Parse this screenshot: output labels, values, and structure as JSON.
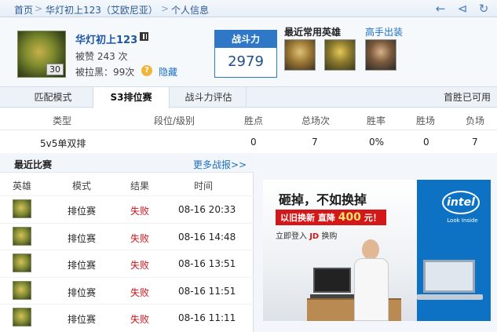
{
  "breadcrumb": {
    "home": "首页",
    "separator": ">",
    "player": "华灯初上123（艾欧尼亚）",
    "profile": "个人信息"
  },
  "toolbar_icons": [
    "back-arrow-icon",
    "share-icon",
    "refresh-icon"
  ],
  "profile": {
    "name": "华灯初上123",
    "level": "30",
    "likes": "被赞 243 次",
    "blacklist": "被拉黑：99次",
    "hide_link": "隐藏",
    "help_icon": "?"
  },
  "power": {
    "title": "战斗力",
    "value": "2979"
  },
  "favorite_heroes": {
    "title": "最近常用英雄",
    "master_link": "高手出装"
  },
  "tabs": [
    "匹配模式",
    "S3排位赛",
    "战斗力评估"
  ],
  "first_win": "首胜已可用",
  "ranked_table": {
    "headers": [
      "类型",
      "段位/级别",
      "胜点",
      "总场次",
      "胜率",
      "胜场",
      "负场"
    ],
    "row": [
      "5v5单双排",
      "",
      "0",
      "7",
      "0%",
      "0",
      "7"
    ]
  },
  "recent_games": {
    "title": "最近比赛",
    "more_link": "更多战报>>",
    "headers": [
      "英雄",
      "模式",
      "结果",
      "时间"
    ],
    "rows": [
      {
        "mode": "排位赛",
        "result": "失败",
        "time": "08-16 20:33"
      },
      {
        "mode": "排位赛",
        "result": "失败",
        "time": "08-16 14:48"
      },
      {
        "mode": "排位赛",
        "result": "失败",
        "time": "08-16 13:51"
      },
      {
        "mode": "排位赛",
        "result": "失败",
        "time": "08-16 11:51"
      },
      {
        "mode": "排位赛",
        "result": "失败",
        "time": "08-16 11:11"
      }
    ]
  },
  "ad": {
    "headline": "砸掉，不如换掉",
    "promo_prefix": "以旧换新 直降",
    "promo_amount": "400",
    "promo_suffix": "元！",
    "sub_prefix": "立即登入",
    "sub_jd": "JD",
    "sub_suffix": "换购",
    "brand": "intel",
    "brand_tag": "Look Inside"
  },
  "colors": {
    "link": "#1d6fc2",
    "power_blue": "#2f78c8",
    "loss_red": "#c8151b",
    "ad_blue": "#0d72c4"
  }
}
